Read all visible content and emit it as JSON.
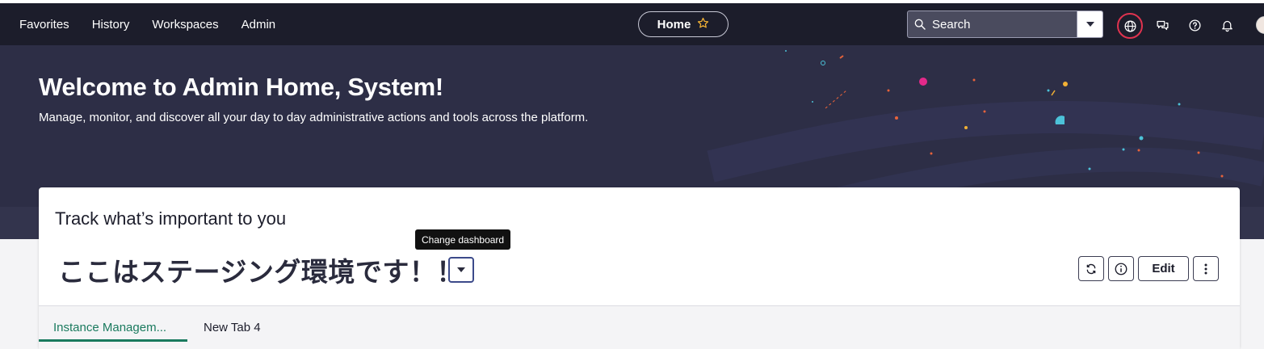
{
  "topnav": {
    "items": [
      "Favorites",
      "History",
      "Workspaces",
      "Admin"
    ],
    "home_label": "Home",
    "search_placeholder": "Search"
  },
  "hero": {
    "title": "Welcome to Admin Home, System!",
    "subtitle": "Manage, monitor, and discover all your day to day administrative actions and tools across the platform."
  },
  "dashboard": {
    "heading": "Track what’s important to you",
    "title": "ここはステージング環境です！！",
    "tooltip": "Change dashboard",
    "edit_label": "Edit",
    "tabs": [
      {
        "label": "Instance Managem...",
        "active": true
      },
      {
        "label": "New Tab 4",
        "active": false
      }
    ]
  },
  "colors": {
    "topbar": "#1c1d2b",
    "hero": "#2d2e46",
    "accent_tab": "#1a7a5e",
    "globe_ring": "#e0334f"
  }
}
